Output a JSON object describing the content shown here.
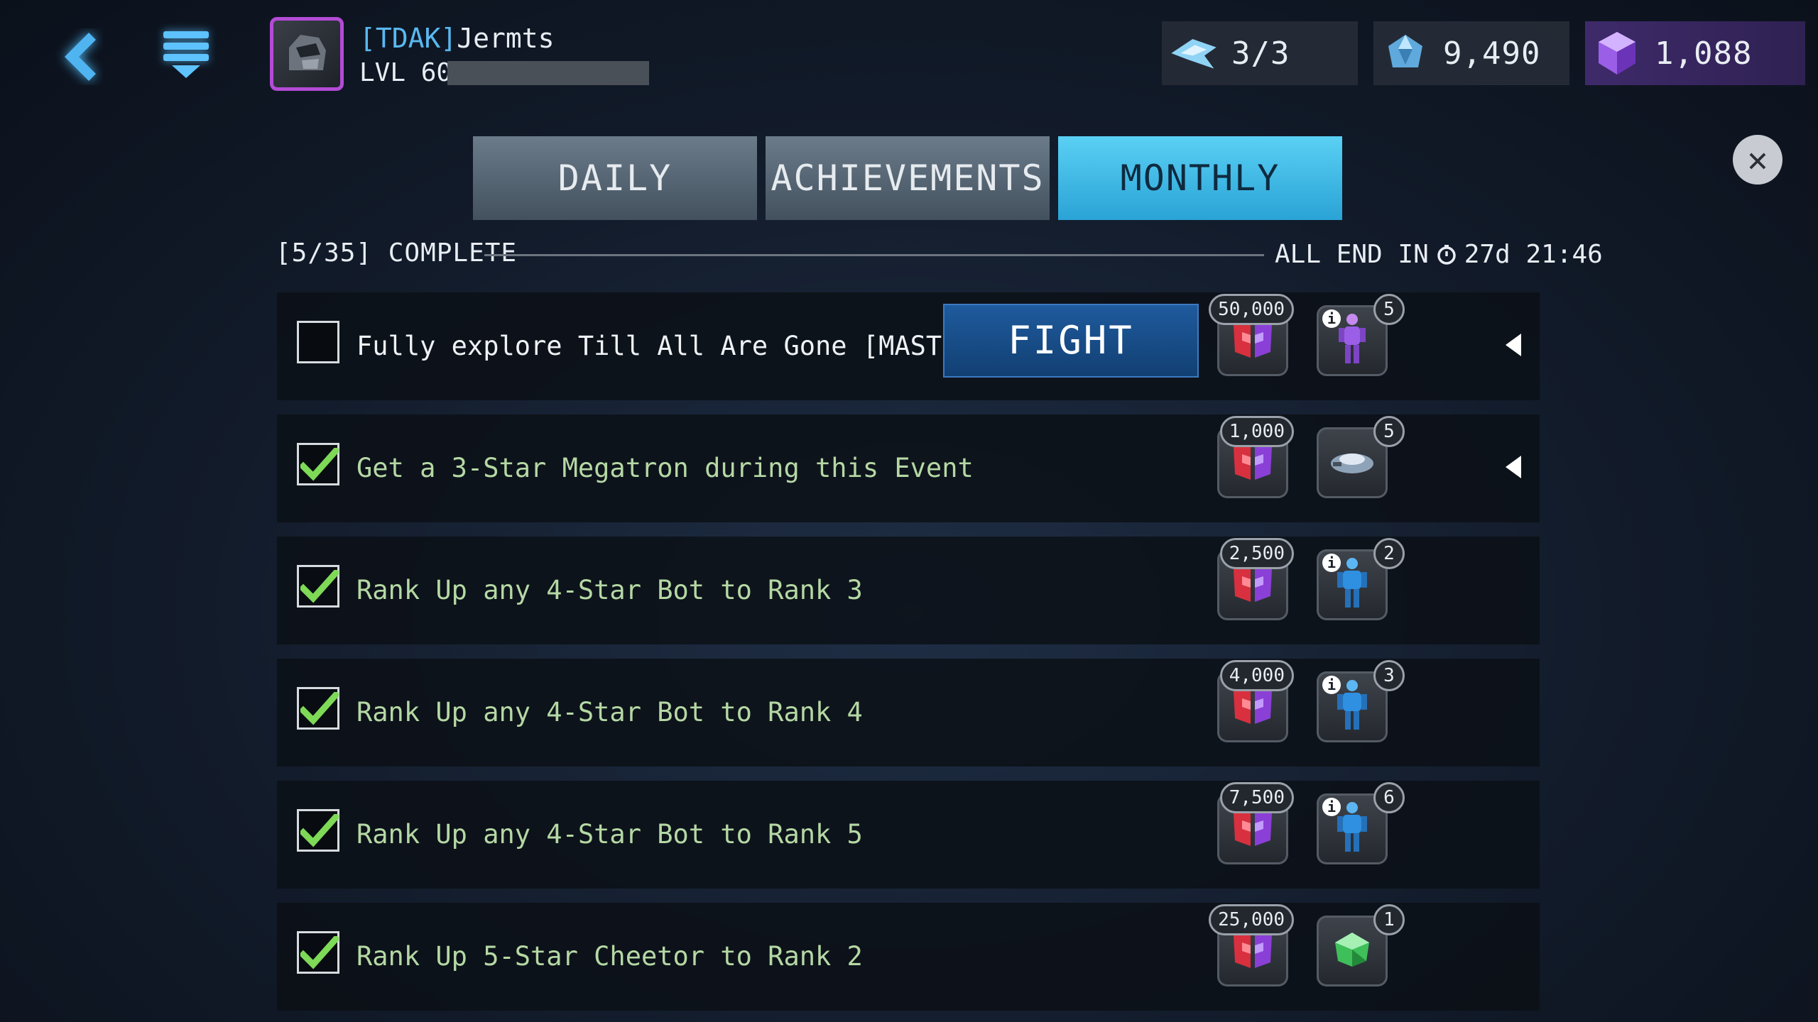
{
  "header": {
    "alliance_tag": "[TDAK]",
    "player_name": "Jermts",
    "level_label": "LVL 60",
    "avatar_icon": "bot-avatar-icon",
    "back_icon": "chevron-left-icon",
    "menu_icon": "menu-icon"
  },
  "resources": {
    "energy": {
      "icon": "energy-wing-icon",
      "value": "3/3"
    },
    "shards": {
      "icon": "crystal-shard-icon",
      "value": "9,490"
    },
    "gems": {
      "icon": "purple-gem-icon",
      "value": "1,088"
    }
  },
  "tabs": [
    {
      "label": "DAILY",
      "active": false
    },
    {
      "label": "ACHIEVEMENTS",
      "active": false
    },
    {
      "label": "MONTHLY",
      "active": true
    }
  ],
  "progress": {
    "complete_label": "[5/35] COMPLETE",
    "end_prefix": "ALL END IN",
    "end_time": "27d 21:46"
  },
  "tasks": [
    {
      "text": "Fully explore Till All Are Gone [MASTER]",
      "done": false,
      "action_label": "FIGHT",
      "reward1_amount": "50,000",
      "reward1_icon": "faction-currency-icon",
      "reward2_count": "5",
      "reward2_icon": "purple-bot-icon",
      "reward2_info": true,
      "expandable": true
    },
    {
      "text": "Get a 3-Star Megatron during this Event",
      "done": true,
      "reward1_amount": "1,000",
      "reward1_icon": "faction-currency-icon",
      "reward2_count": "5",
      "reward2_icon": "vehicle-part-icon",
      "reward2_info": false,
      "expandable": true
    },
    {
      "text": "Rank Up any 4-Star Bot to Rank 3",
      "done": true,
      "reward1_amount": "2,500",
      "reward1_icon": "faction-currency-icon",
      "reward2_count": "2",
      "reward2_icon": "blue-bot-icon",
      "reward2_info": true,
      "expandable": false
    },
    {
      "text": "Rank Up any 4-Star Bot to Rank 4",
      "done": true,
      "reward1_amount": "4,000",
      "reward1_icon": "faction-currency-icon",
      "reward2_count": "3",
      "reward2_icon": "blue-bot-icon",
      "reward2_info": true,
      "expandable": false
    },
    {
      "text": "Rank Up any 4-Star Bot to Rank 5",
      "done": true,
      "reward1_amount": "7,500",
      "reward1_icon": "faction-currency-icon",
      "reward2_count": "6",
      "reward2_icon": "blue-bot-icon",
      "reward2_info": true,
      "expandable": false
    },
    {
      "text": "Rank Up 5-Star Cheetor to Rank 2",
      "done": true,
      "reward1_amount": "25,000",
      "reward1_icon": "faction-currency-icon",
      "reward2_count": "1",
      "reward2_icon": "green-gem-icon",
      "reward2_info": false,
      "expandable": false
    }
  ],
  "colors": {
    "active_tab": "#5ad0f4",
    "done_text": "#b5d8a4",
    "check": "#7ed957",
    "gem_panel": "#3e2a6a"
  }
}
